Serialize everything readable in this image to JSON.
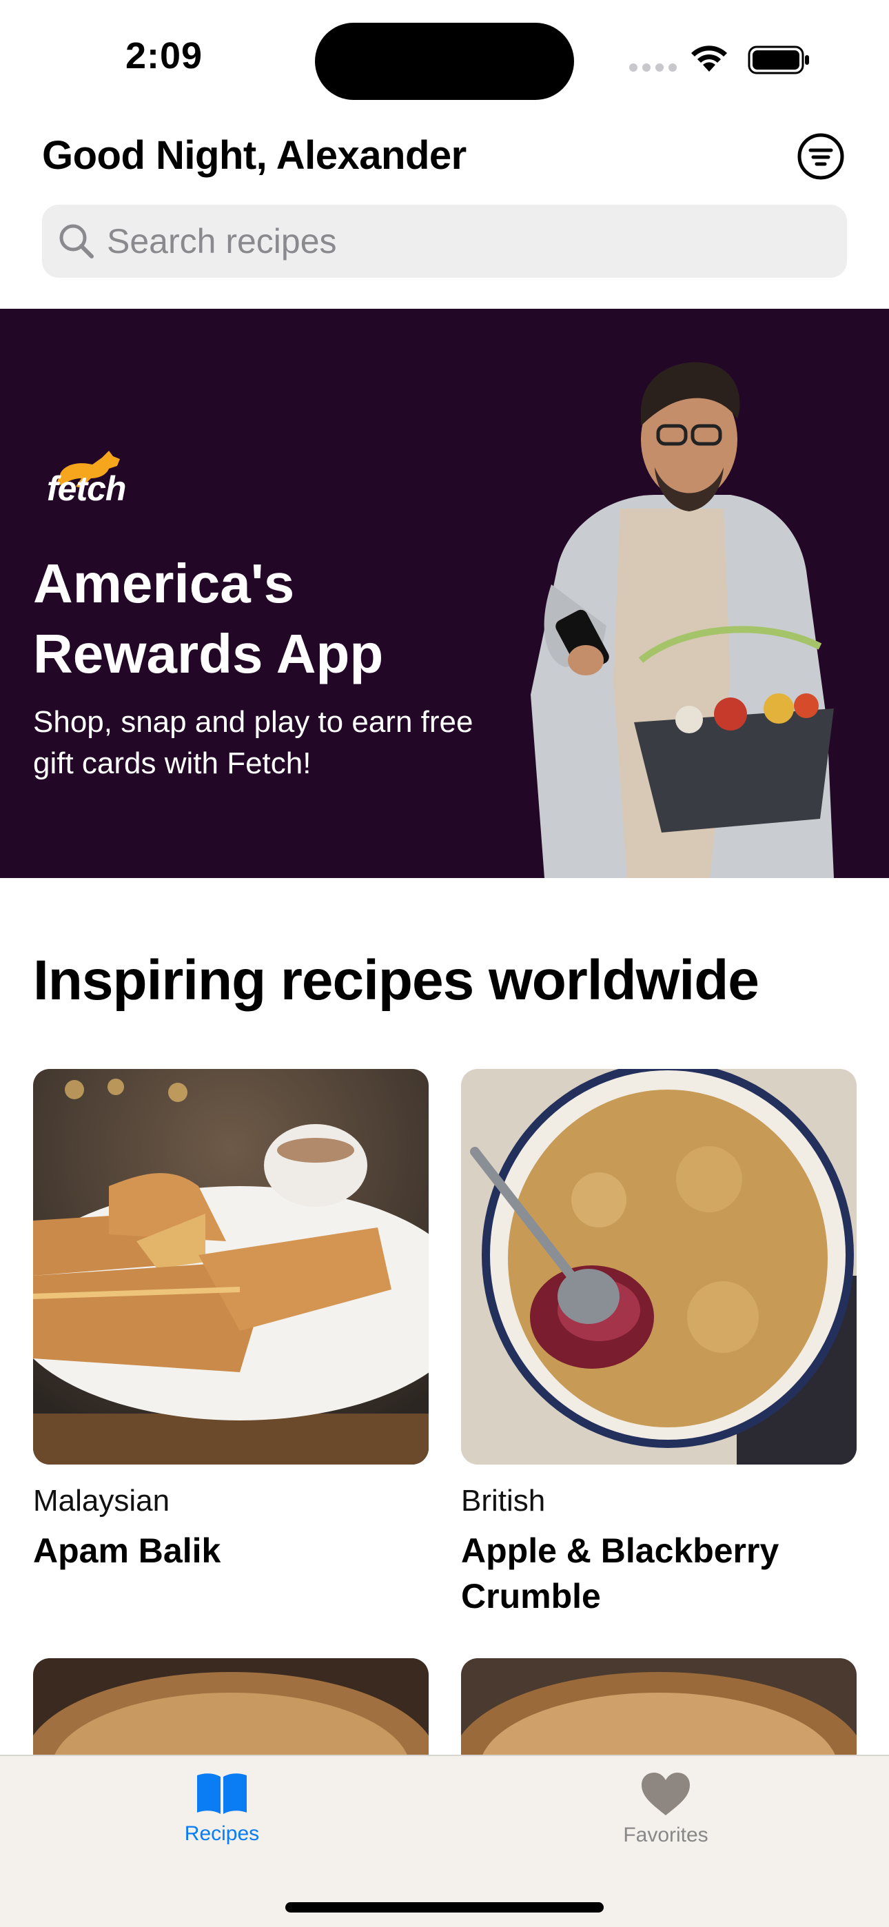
{
  "status_bar": {
    "time": "2:09"
  },
  "header": {
    "greeting": "Good Night, Alexander",
    "search_placeholder": "Search recipes"
  },
  "banner": {
    "brand": "fetch",
    "title": "America's Rewards App",
    "subtitle": "Shop, snap and play to earn free gift cards with Fetch!",
    "bg_color": "#230727",
    "accent_color": "#f6a61c"
  },
  "section": {
    "title": "Inspiring recipes worldwide"
  },
  "recipes": [
    {
      "cuisine": "Malaysian",
      "name": "Apam Balik"
    },
    {
      "cuisine": "British",
      "name": "Apple & Blackberry Crumble"
    }
  ],
  "tab_bar": {
    "tabs": [
      {
        "label": "Recipes",
        "icon": "book-icon",
        "active": true
      },
      {
        "label": "Favorites",
        "icon": "heart-icon",
        "active": false
      }
    ],
    "active_color": "#0a7df5"
  }
}
